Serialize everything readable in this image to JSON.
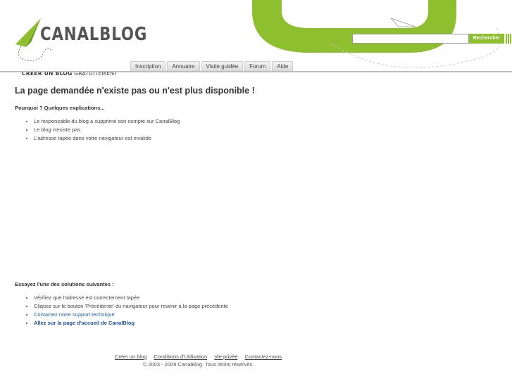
{
  "header": {
    "logo_text": "CANALBLOG",
    "tagline_bold": "CRÉER UN BLOG",
    "tagline_light": " GRATUITEMENT",
    "nav": [
      "Inscription",
      "Annuaire",
      "Visite guidée",
      "Forum",
      "Aide"
    ],
    "search": {
      "value": "",
      "button_label": "Rechercher"
    },
    "accent_color": "#8ebf2e"
  },
  "main": {
    "title": "La page demandée n'existe pas ou n'est plus disponible !",
    "reasons_heading": "Pourquoi ? Quelques explications...",
    "reasons": [
      "Le responsable du blog a supprimé son compte sur CanalBlog",
      "Le blog n'existe pas",
      "L'adresse tapée dans votre navigateur est invalide"
    ],
    "solutions_heading": "Essayez l'une des solutions suivantes :",
    "solutions": [
      "Vérifiez que l'adresse est correctement tapée",
      "Cliquez sur le bouton 'Précédente' du navigateur pour revenir à la page précédente"
    ],
    "support_link": "Contactez notre support technique",
    "home_link": "Allez sur la page d'accueil de CanalBlog"
  },
  "footer": {
    "links": [
      "Créer un blog",
      "Conditions d'Utilisation",
      "Vie privée",
      "Contactez-nous"
    ],
    "copyright": "© 2003 - 2009 CanalBlog. Tous droits réservés."
  }
}
